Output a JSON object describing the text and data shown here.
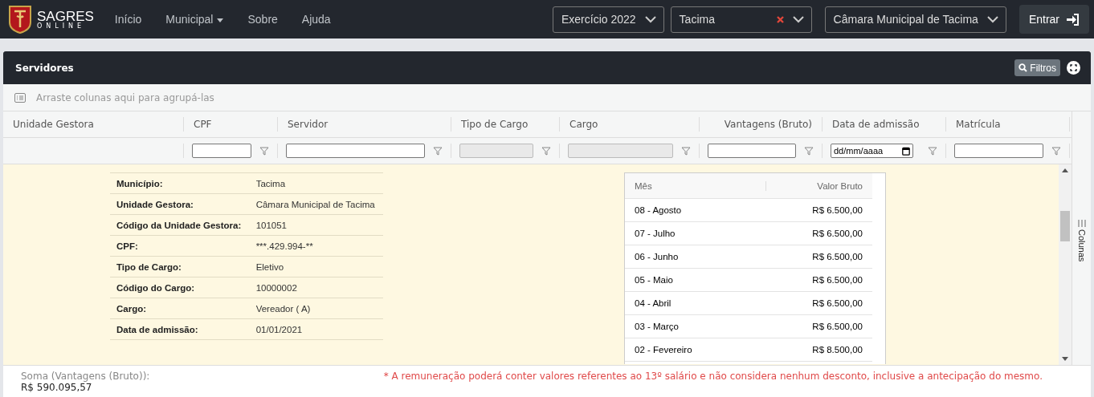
{
  "navbar": {
    "brand": "SAGRES",
    "brand_sub": "ONLINE",
    "links": [
      {
        "label": "Início",
        "dropdown": false
      },
      {
        "label": "Municipal",
        "dropdown": true
      },
      {
        "label": "Sobre",
        "dropdown": false
      },
      {
        "label": "Ajuda",
        "dropdown": false
      }
    ],
    "selects": [
      {
        "value": "Exercício  2022",
        "clearable": false
      },
      {
        "value": "Tacima",
        "clearable": true
      },
      {
        "value": "Câmara Municipal de Tacima",
        "clearable": false
      }
    ],
    "login_button": "Entrar"
  },
  "panel": {
    "title": "Servidores",
    "filter_button": "Filtros"
  },
  "grid": {
    "group_hint": "Arraste colunas aqui para agrupá-las",
    "columns": [
      {
        "label": "Unidade Gestora",
        "kind": "plain"
      },
      {
        "label": "CPF",
        "kind": "text"
      },
      {
        "label": "Servidor",
        "kind": "text"
      },
      {
        "label": "Tipo de Cargo",
        "kind": "locked"
      },
      {
        "label": "Cargo",
        "kind": "locked"
      },
      {
        "label": "Vantagens (Bruto)",
        "kind": "number"
      },
      {
        "label": "Data de admissão",
        "kind": "date",
        "placeholder": "dd/mm/aaaa"
      },
      {
        "label": "Matrícula",
        "kind": "text"
      }
    ],
    "side_panel": "Colunas",
    "detail": {
      "fields": [
        {
          "label": "Município:",
          "value": "Tacima"
        },
        {
          "label": "Unidade Gestora:",
          "value": "Câmara Municipal de Tacima"
        },
        {
          "label": "Código da Unidade Gestora:",
          "value": "101051"
        },
        {
          "label": "CPF:",
          "value": "***.429.994-**"
        },
        {
          "label": "Tipo de Cargo:",
          "value": "Eletivo"
        },
        {
          "label": "Código do Cargo:",
          "value": "10000002"
        },
        {
          "label": "Cargo:",
          "value": "Vereador ( A)"
        },
        {
          "label": "Data de admissão:",
          "value": "01/01/2021"
        }
      ],
      "months": {
        "columns": [
          "Mês",
          "Valor Bruto"
        ],
        "rows": [
          [
            "08 - Agosto",
            "R$ 6.500,00"
          ],
          [
            "07 - Julho",
            "R$ 6.500,00"
          ],
          [
            "06 - Junho",
            "R$ 6.500,00"
          ],
          [
            "05 - Maio",
            "R$ 6.500,00"
          ],
          [
            "04 - Abril",
            "R$ 6.500,00"
          ],
          [
            "03 - Março",
            "R$ 6.500,00"
          ],
          [
            "02 - Fevereiro",
            "R$ 8.500,00"
          ]
        ]
      }
    }
  },
  "footer": {
    "sum_label": "Soma (Vantagens (Bruto)):",
    "sum_value": "R$ 590.095,57",
    "note": "* A remuneração poderá conter valores referentes ao 13º salário e não considera nenhum desconto, inclusive a antecipação do mesmo."
  }
}
